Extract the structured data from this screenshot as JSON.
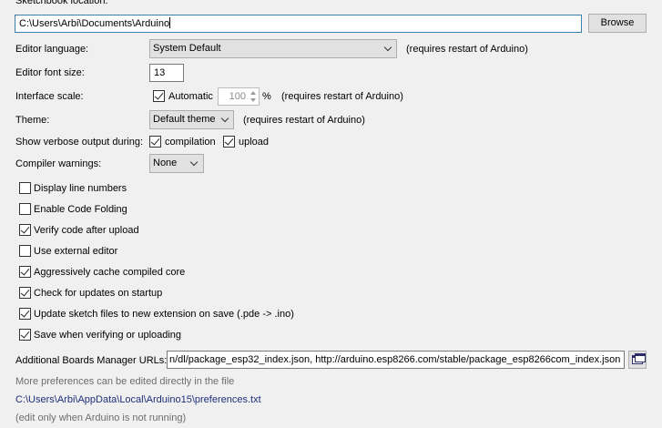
{
  "sketchbook": {
    "label": "Sketchbook location:",
    "path": "C:\\Users\\Arbi\\Documents\\Arduino",
    "browse_label": "Browse"
  },
  "editor_language": {
    "label": "Editor language:",
    "value": "System Default",
    "note": "(requires restart of Arduino)"
  },
  "font_size": {
    "label": "Editor font size:",
    "value": "13"
  },
  "interface_scale": {
    "label": "Interface scale:",
    "automatic_label": "Automatic",
    "automatic_checked": true,
    "value": "100",
    "unit": "%",
    "note": "(requires restart of Arduino)"
  },
  "theme": {
    "label": "Theme:",
    "value": "Default theme",
    "note": "(requires restart of Arduino)"
  },
  "verbose": {
    "label": "Show verbose output during:",
    "compilation_label": "compilation",
    "compilation_checked": true,
    "upload_label": "upload",
    "upload_checked": true
  },
  "warnings": {
    "label": "Compiler warnings:",
    "value": "None"
  },
  "options": [
    {
      "label": "Display line numbers",
      "checked": false
    },
    {
      "label": "Enable Code Folding",
      "checked": false
    },
    {
      "label": "Verify code after upload",
      "checked": true
    },
    {
      "label": "Use external editor",
      "checked": false
    },
    {
      "label": "Aggressively cache compiled core",
      "checked": true
    },
    {
      "label": "Check for updates on startup",
      "checked": true
    },
    {
      "label": "Update sketch files to new extension on save (.pde -> .ino)",
      "checked": true
    },
    {
      "label": "Save when verifying or uploading",
      "checked": true
    }
  ],
  "boards_manager": {
    "label": "Additional Boards Manager URLs:",
    "value": "n/dl/package_esp32_index.json, http://arduino.esp8266.com/stable/package_esp8266com_index.json"
  },
  "footer": {
    "more_text": "More preferences can be edited directly in the file",
    "file_path": "C:\\Users\\Arbi\\AppData\\Local\\Arduino15\\preferences.txt",
    "edit_note": "(edit only when Arduino is not running)"
  },
  "colors": {
    "background": "#f0f0f0",
    "link": "#1f2f7a",
    "muted": "#6d6d6d"
  }
}
